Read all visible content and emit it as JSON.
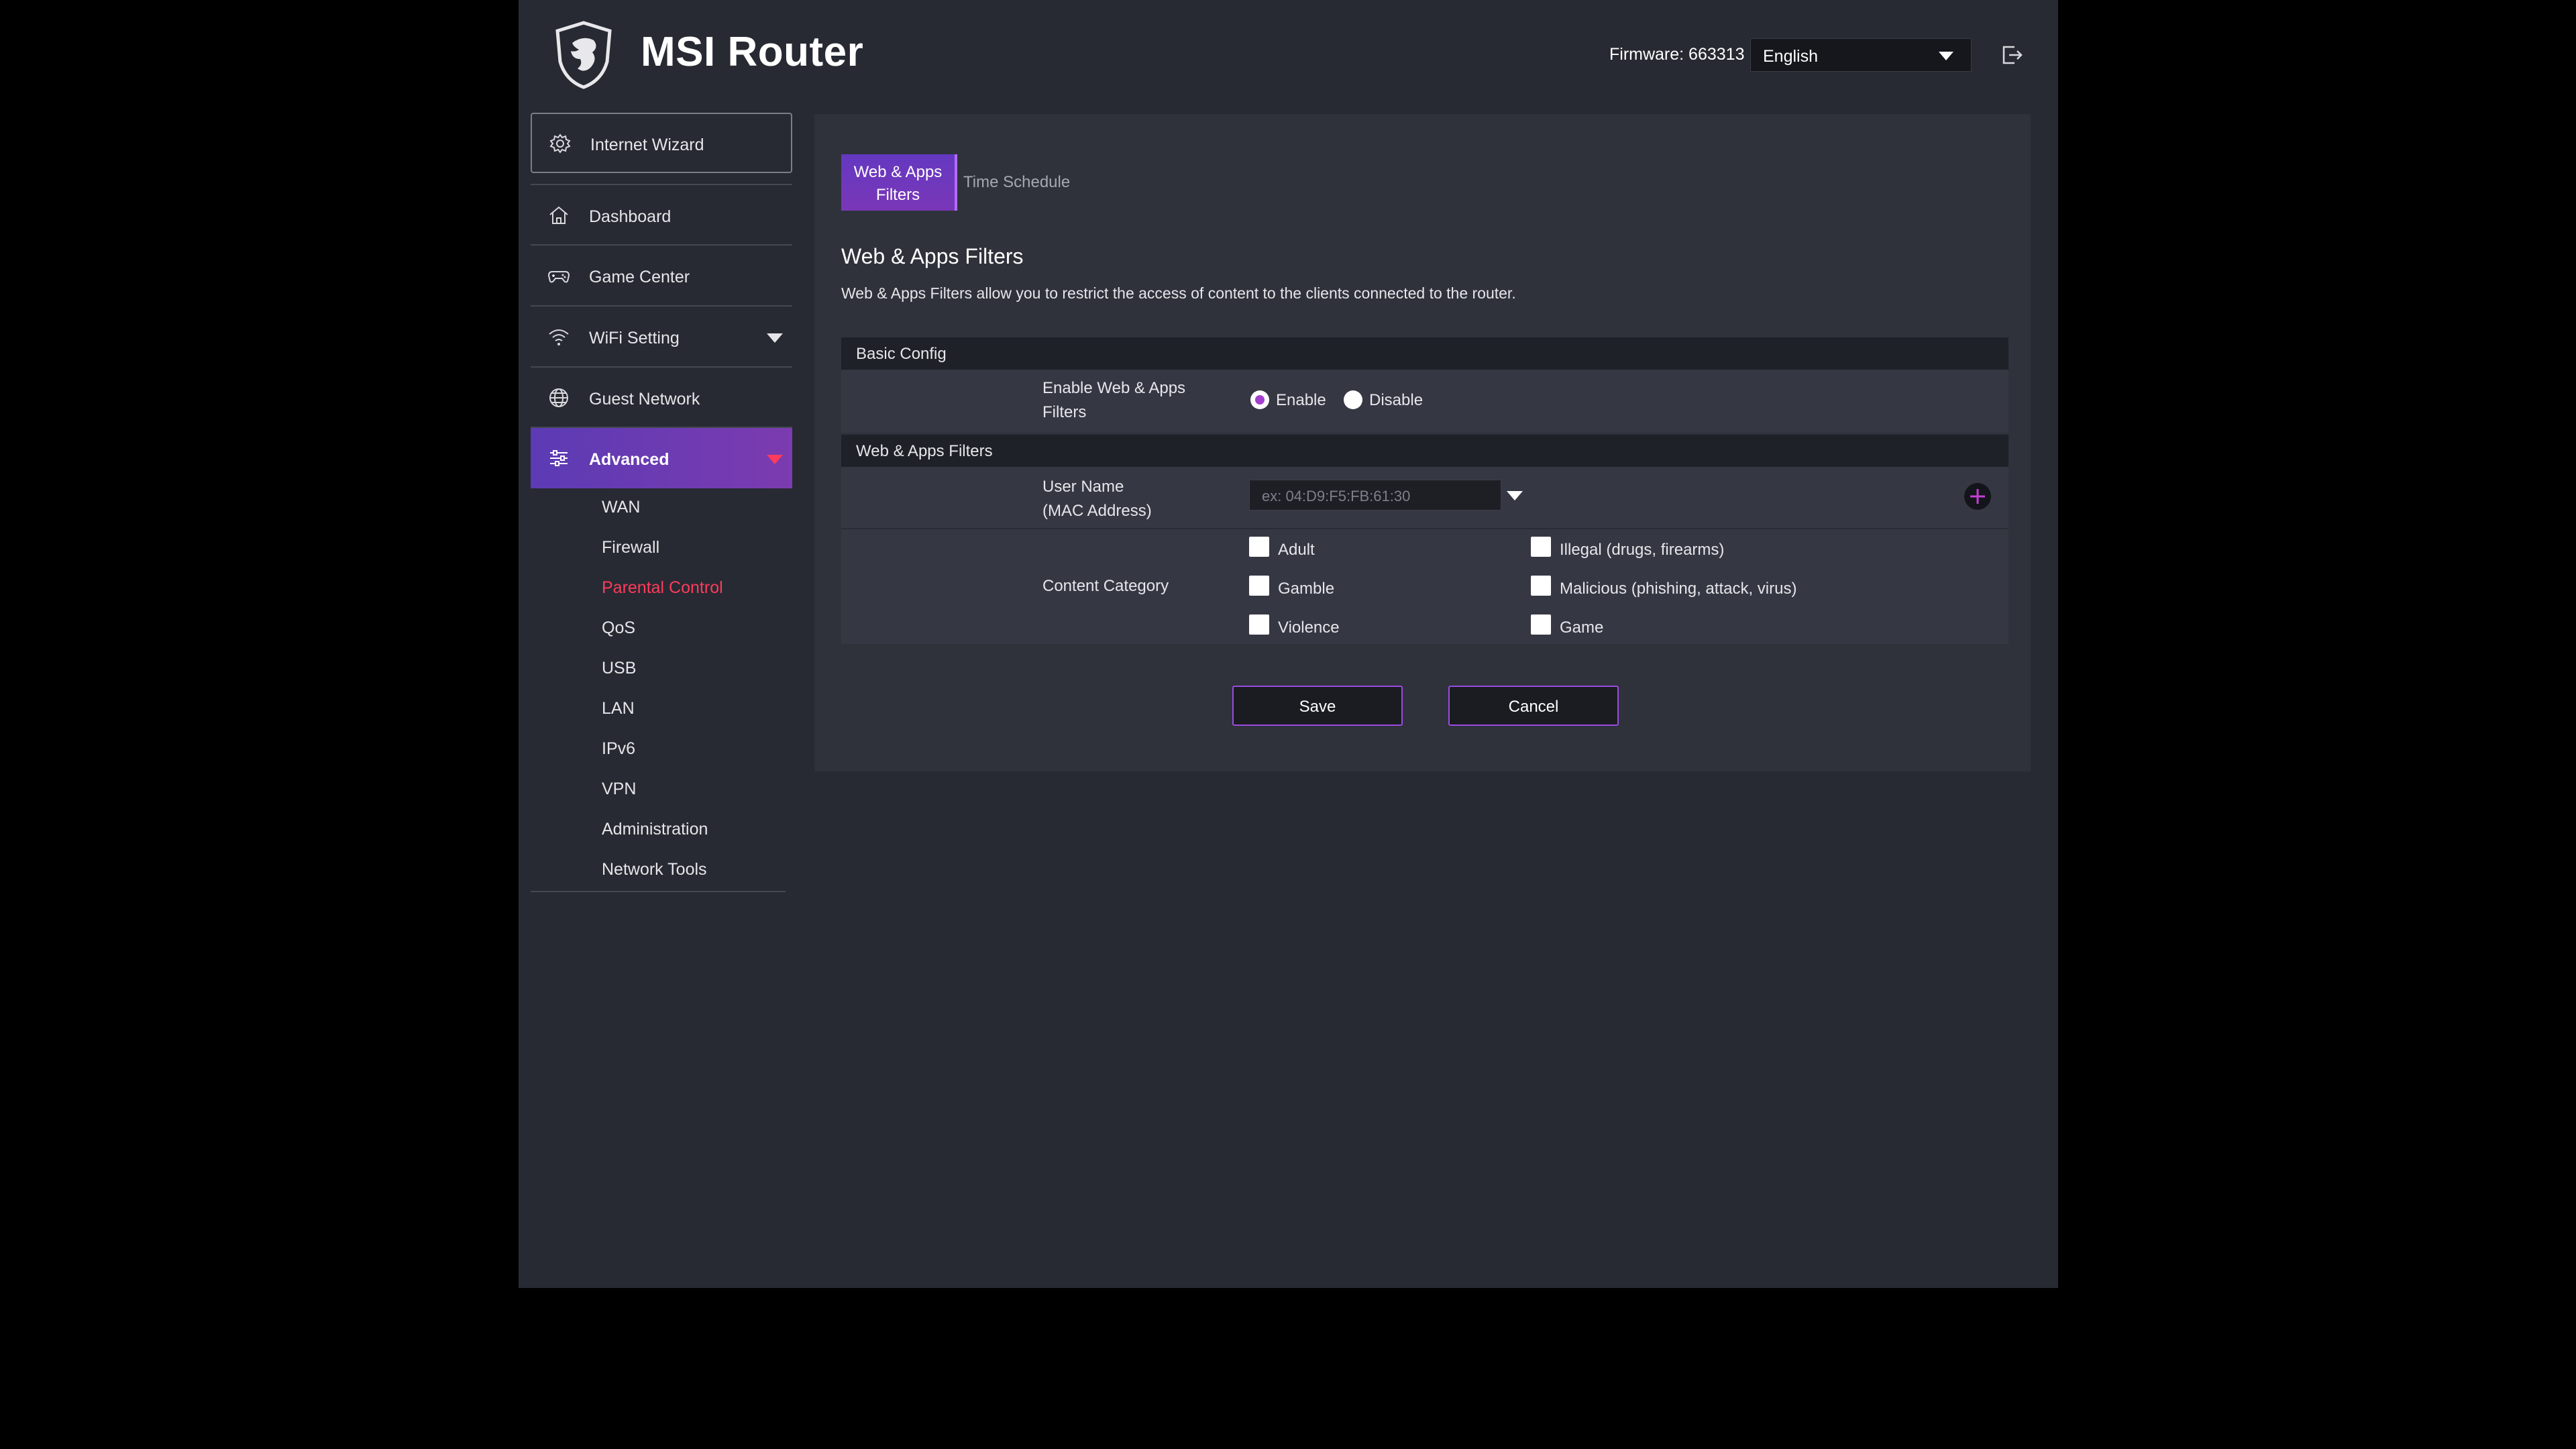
{
  "header": {
    "app_title": "MSI Router",
    "firmware_label": "Firmware: 663313",
    "language": "English",
    "icons": {
      "logo": "msi-dragon-shield-logo",
      "logout": "logout-icon"
    }
  },
  "sidebar": {
    "wizard": {
      "label": "Internet Wizard",
      "icon": "gear-icon"
    },
    "items": [
      {
        "label": "Dashboard",
        "icon": "home-icon"
      },
      {
        "label": "Game Center",
        "icon": "gamepad-icon"
      },
      {
        "label": "WiFi Setting",
        "icon": "wifi-icon",
        "expandable": true
      },
      {
        "label": "Guest Network",
        "icon": "globe-icon"
      },
      {
        "label": "Advanced",
        "icon": "sliders-icon",
        "expandable": true,
        "active": true
      }
    ],
    "sub_items": [
      "WAN",
      "Firewall",
      "Parental Control",
      "QoS",
      "USB",
      "LAN",
      "IPv6",
      "VPN",
      "Administration",
      "Network Tools"
    ],
    "active_sub_item": "Parental Control",
    "accent_color": "#ff3b5c"
  },
  "main": {
    "tabs": [
      {
        "label": "Web & Apps\nFilters",
        "active": true
      },
      {
        "label": "Time Schedule",
        "active": false
      }
    ],
    "title": "Web & Apps Filters",
    "description": "Web & Apps Filters allow you to restrict the access of content to the clients connected to the router.",
    "basic_config": {
      "header": "Basic Config",
      "enable_label": "Enable Web & Apps\nFilters",
      "options": {
        "enable": "Enable",
        "disable": "Disable"
      },
      "selected": "Enable"
    },
    "filters": {
      "header": "Web & Apps Filters",
      "user_label": "User Name\n(MAC Address)",
      "mac_placeholder": "ex: 04:D9:F5:FB:61:30",
      "add_icon": "plus-circle-icon",
      "content_label": "Content Category",
      "categories": [
        "Adult",
        "Illegal (drugs, firearms)",
        "Gamble",
        "Malicious (phishing, attack, virus)",
        "Violence",
        "Game"
      ]
    },
    "buttons": {
      "save": "Save",
      "cancel": "Cancel"
    },
    "brand_color": "#6a3ac0"
  }
}
